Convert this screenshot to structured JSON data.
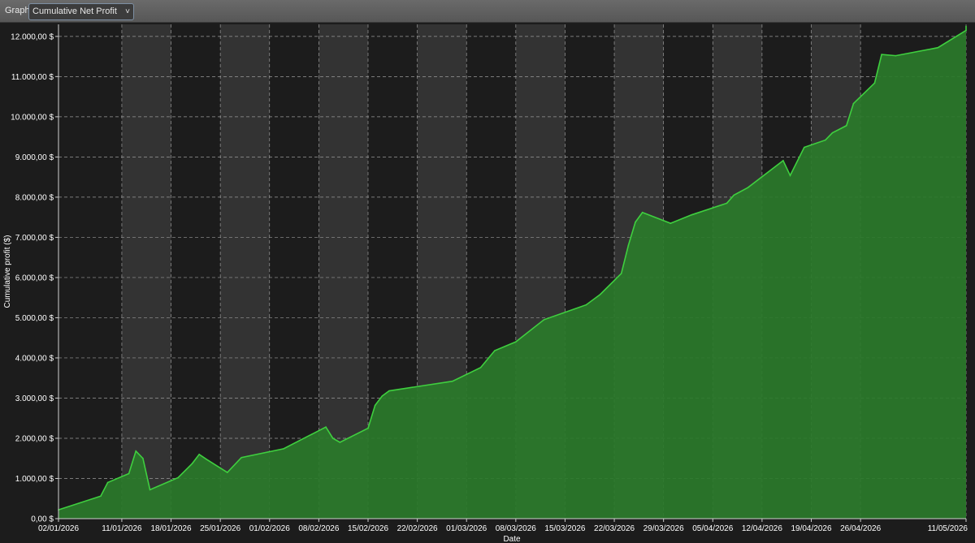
{
  "toolbar": {
    "graph_label": "Graph",
    "selected_graph": "Cumulative Net Profit"
  },
  "colors": {
    "background": "#1c1c1c",
    "alt_band": "#333333",
    "grid": "#9a9a9a",
    "area_fill": "#2a7a2a",
    "area_line": "#3fcf3f"
  },
  "chart_data": {
    "type": "area",
    "xlabel": "Date",
    "ylabel": "Cumulative profit ($)",
    "ylim": [
      0,
      12300
    ],
    "xlim": [
      "2026-01-02",
      "2026-05-11"
    ],
    "grid": true,
    "y_ticks": [
      {
        "value": 0,
        "label": "0,00 $"
      },
      {
        "value": 1000,
        "label": "1.000,00 $"
      },
      {
        "value": 2000,
        "label": "2.000,00 $"
      },
      {
        "value": 3000,
        "label": "3.000,00 $"
      },
      {
        "value": 4000,
        "label": "4.000,00 $"
      },
      {
        "value": 5000,
        "label": "5.000,00 $"
      },
      {
        "value": 6000,
        "label": "6.000,00 $"
      },
      {
        "value": 7000,
        "label": "7.000,00 $"
      },
      {
        "value": 8000,
        "label": "8.000,00 $"
      },
      {
        "value": 9000,
        "label": "9.000,00 $"
      },
      {
        "value": 10000,
        "label": "10.000,00 $"
      },
      {
        "value": 11000,
        "label": "11.000,00 $"
      },
      {
        "value": 12000,
        "label": "12.000,00 $"
      }
    ],
    "x_ticks": [
      {
        "date": "2026-01-02",
        "label": "02/01/2026"
      },
      {
        "date": "2026-01-11",
        "label": "11/01/2026"
      },
      {
        "date": "2026-01-18",
        "label": "18/01/2026"
      },
      {
        "date": "2026-01-25",
        "label": "25/01/2026"
      },
      {
        "date": "2026-02-01",
        "label": "01/02/2026"
      },
      {
        "date": "2026-02-08",
        "label": "08/02/2026"
      },
      {
        "date": "2026-02-15",
        "label": "15/02/2026"
      },
      {
        "date": "2026-02-22",
        "label": "22/02/2026"
      },
      {
        "date": "2026-03-01",
        "label": "01/03/2026"
      },
      {
        "date": "2026-03-08",
        "label": "08/03/2026"
      },
      {
        "date": "2026-03-15",
        "label": "15/03/2026"
      },
      {
        "date": "2026-03-22",
        "label": "22/03/2026"
      },
      {
        "date": "2026-03-29",
        "label": "29/03/2026"
      },
      {
        "date": "2026-04-05",
        "label": "05/04/2026"
      },
      {
        "date": "2026-04-12",
        "label": "12/04/2026"
      },
      {
        "date": "2026-04-19",
        "label": "19/04/2026"
      },
      {
        "date": "2026-04-26",
        "label": "26/04/2026"
      },
      {
        "date": "2026-05-11",
        "label": "11/05/2026"
      }
    ],
    "bands": [
      [
        "2026-01-11",
        "2026-01-18"
      ],
      [
        "2026-01-25",
        "2026-02-01"
      ],
      [
        "2026-02-08",
        "2026-02-15"
      ],
      [
        "2026-02-22",
        "2026-03-01"
      ],
      [
        "2026-03-08",
        "2026-03-15"
      ],
      [
        "2026-03-22",
        "2026-03-29"
      ],
      [
        "2026-04-05",
        "2026-04-12"
      ],
      [
        "2026-04-19",
        "2026-04-26"
      ]
    ],
    "series": [
      {
        "points": [
          {
            "x": "2026-01-02",
            "y": 220
          },
          {
            "x": "2026-01-08",
            "y": 560
          },
          {
            "x": "2026-01-09",
            "y": 900
          },
          {
            "x": "2026-01-12",
            "y": 1120
          },
          {
            "x": "2026-01-13",
            "y": 1680
          },
          {
            "x": "2026-01-14",
            "y": 1500
          },
          {
            "x": "2026-01-15",
            "y": 720
          },
          {
            "x": "2026-01-19",
            "y": 1020
          },
          {
            "x": "2026-01-21",
            "y": 1370
          },
          {
            "x": "2026-01-22",
            "y": 1600
          },
          {
            "x": "2026-01-23",
            "y": 1480
          },
          {
            "x": "2026-01-26",
            "y": 1150
          },
          {
            "x": "2026-01-28",
            "y": 1520
          },
          {
            "x": "2026-02-03",
            "y": 1740
          },
          {
            "x": "2026-02-07",
            "y": 2100
          },
          {
            "x": "2026-02-09",
            "y": 2280
          },
          {
            "x": "2026-02-10",
            "y": 2000
          },
          {
            "x": "2026-02-11",
            "y": 1900
          },
          {
            "x": "2026-02-15",
            "y": 2250
          },
          {
            "x": "2026-02-16",
            "y": 2820
          },
          {
            "x": "2026-02-17",
            "y": 3050
          },
          {
            "x": "2026-02-18",
            "y": 3180
          },
          {
            "x": "2026-02-27",
            "y": 3420
          },
          {
            "x": "2026-03-03",
            "y": 3760
          },
          {
            "x": "2026-03-05",
            "y": 4180
          },
          {
            "x": "2026-03-08",
            "y": 4400
          },
          {
            "x": "2026-03-12",
            "y": 4950
          },
          {
            "x": "2026-03-18",
            "y": 5320
          },
          {
            "x": "2026-03-20",
            "y": 5580
          },
          {
            "x": "2026-03-23",
            "y": 6100
          },
          {
            "x": "2026-03-24",
            "y": 6800
          },
          {
            "x": "2026-03-25",
            "y": 7380
          },
          {
            "x": "2026-03-26",
            "y": 7620
          },
          {
            "x": "2026-03-30",
            "y": 7350
          },
          {
            "x": "2026-04-02",
            "y": 7560
          },
          {
            "x": "2026-04-07",
            "y": 7850
          },
          {
            "x": "2026-04-08",
            "y": 8050
          },
          {
            "x": "2026-04-10",
            "y": 8240
          },
          {
            "x": "2026-04-15",
            "y": 8910
          },
          {
            "x": "2026-04-16",
            "y": 8540
          },
          {
            "x": "2026-04-18",
            "y": 9240
          },
          {
            "x": "2026-04-21",
            "y": 9420
          },
          {
            "x": "2026-04-22",
            "y": 9600
          },
          {
            "x": "2026-04-24",
            "y": 9780
          },
          {
            "x": "2026-04-25",
            "y": 10330
          },
          {
            "x": "2026-04-28",
            "y": 10840
          },
          {
            "x": "2026-04-29",
            "y": 11550
          },
          {
            "x": "2026-05-01",
            "y": 11520
          },
          {
            "x": "2026-05-07",
            "y": 11720
          },
          {
            "x": "2026-05-11",
            "y": 12150
          },
          {
            "x": "2026-05-12",
            "y": 12250
          }
        ]
      }
    ]
  }
}
